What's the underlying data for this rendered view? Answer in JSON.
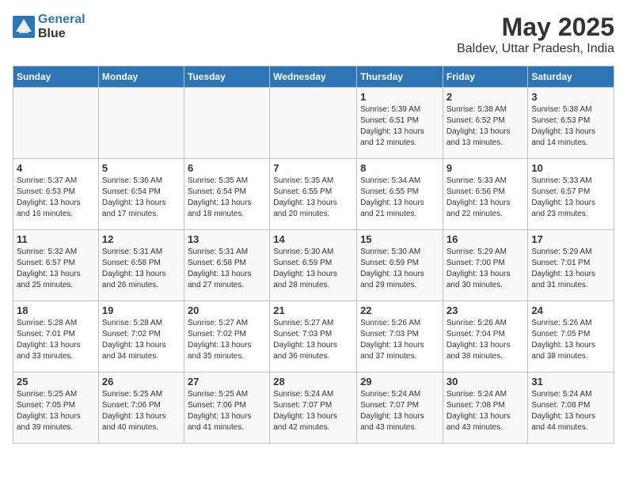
{
  "header": {
    "logo_line1": "General",
    "logo_line2": "Blue",
    "month_year": "May 2025",
    "location": "Baldev, Uttar Pradesh, India"
  },
  "days_of_week": [
    "Sunday",
    "Monday",
    "Tuesday",
    "Wednesday",
    "Thursday",
    "Friday",
    "Saturday"
  ],
  "weeks": [
    [
      {
        "day": "",
        "info": ""
      },
      {
        "day": "",
        "info": ""
      },
      {
        "day": "",
        "info": ""
      },
      {
        "day": "",
        "info": ""
      },
      {
        "day": "1",
        "info": "Sunrise: 5:39 AM\nSunset: 6:51 PM\nDaylight: 13 hours\nand 12 minutes."
      },
      {
        "day": "2",
        "info": "Sunrise: 5:38 AM\nSunset: 6:52 PM\nDaylight: 13 hours\nand 13 minutes."
      },
      {
        "day": "3",
        "info": "Sunrise: 5:38 AM\nSunset: 6:53 PM\nDaylight: 13 hours\nand 14 minutes."
      }
    ],
    [
      {
        "day": "4",
        "info": "Sunrise: 5:37 AM\nSunset: 6:53 PM\nDaylight: 13 hours\nand 16 minutes."
      },
      {
        "day": "5",
        "info": "Sunrise: 5:36 AM\nSunset: 6:54 PM\nDaylight: 13 hours\nand 17 minutes."
      },
      {
        "day": "6",
        "info": "Sunrise: 5:35 AM\nSunset: 6:54 PM\nDaylight: 13 hours\nand 18 minutes."
      },
      {
        "day": "7",
        "info": "Sunrise: 5:35 AM\nSunset: 6:55 PM\nDaylight: 13 hours\nand 20 minutes."
      },
      {
        "day": "8",
        "info": "Sunrise: 5:34 AM\nSunset: 6:55 PM\nDaylight: 13 hours\nand 21 minutes."
      },
      {
        "day": "9",
        "info": "Sunrise: 5:33 AM\nSunset: 6:56 PM\nDaylight: 13 hours\nand 22 minutes."
      },
      {
        "day": "10",
        "info": "Sunrise: 5:33 AM\nSunset: 6:57 PM\nDaylight: 13 hours\nand 23 minutes."
      }
    ],
    [
      {
        "day": "11",
        "info": "Sunrise: 5:32 AM\nSunset: 6:57 PM\nDaylight: 13 hours\nand 25 minutes."
      },
      {
        "day": "12",
        "info": "Sunrise: 5:31 AM\nSunset: 6:58 PM\nDaylight: 13 hours\nand 26 minutes."
      },
      {
        "day": "13",
        "info": "Sunrise: 5:31 AM\nSunset: 6:58 PM\nDaylight: 13 hours\nand 27 minutes."
      },
      {
        "day": "14",
        "info": "Sunrise: 5:30 AM\nSunset: 6:59 PM\nDaylight: 13 hours\nand 28 minutes."
      },
      {
        "day": "15",
        "info": "Sunrise: 5:30 AM\nSunset: 6:59 PM\nDaylight: 13 hours\nand 29 minutes."
      },
      {
        "day": "16",
        "info": "Sunrise: 5:29 AM\nSunset: 7:00 PM\nDaylight: 13 hours\nand 30 minutes."
      },
      {
        "day": "17",
        "info": "Sunrise: 5:29 AM\nSunset: 7:01 PM\nDaylight: 13 hours\nand 31 minutes."
      }
    ],
    [
      {
        "day": "18",
        "info": "Sunrise: 5:28 AM\nSunset: 7:01 PM\nDaylight: 13 hours\nand 33 minutes."
      },
      {
        "day": "19",
        "info": "Sunrise: 5:28 AM\nSunset: 7:02 PM\nDaylight: 13 hours\nand 34 minutes."
      },
      {
        "day": "20",
        "info": "Sunrise: 5:27 AM\nSunset: 7:02 PM\nDaylight: 13 hours\nand 35 minutes."
      },
      {
        "day": "21",
        "info": "Sunrise: 5:27 AM\nSunset: 7:03 PM\nDaylight: 13 hours\nand 36 minutes."
      },
      {
        "day": "22",
        "info": "Sunrise: 5:26 AM\nSunset: 7:03 PM\nDaylight: 13 hours\nand 37 minutes."
      },
      {
        "day": "23",
        "info": "Sunrise: 5:26 AM\nSunset: 7:04 PM\nDaylight: 13 hours\nand 38 minutes."
      },
      {
        "day": "24",
        "info": "Sunrise: 5:26 AM\nSunset: 7:05 PM\nDaylight: 13 hours\nand 38 minutes."
      }
    ],
    [
      {
        "day": "25",
        "info": "Sunrise: 5:25 AM\nSunset: 7:05 PM\nDaylight: 13 hours\nand 39 minutes."
      },
      {
        "day": "26",
        "info": "Sunrise: 5:25 AM\nSunset: 7:06 PM\nDaylight: 13 hours\nand 40 minutes."
      },
      {
        "day": "27",
        "info": "Sunrise: 5:25 AM\nSunset: 7:06 PM\nDaylight: 13 hours\nand 41 minutes."
      },
      {
        "day": "28",
        "info": "Sunrise: 5:24 AM\nSunset: 7:07 PM\nDaylight: 13 hours\nand 42 minutes."
      },
      {
        "day": "29",
        "info": "Sunrise: 5:24 AM\nSunset: 7:07 PM\nDaylight: 13 hours\nand 43 minutes."
      },
      {
        "day": "30",
        "info": "Sunrise: 5:24 AM\nSunset: 7:08 PM\nDaylight: 13 hours\nand 43 minutes."
      },
      {
        "day": "31",
        "info": "Sunrise: 5:24 AM\nSunset: 7:08 PM\nDaylight: 13 hours\nand 44 minutes."
      }
    ]
  ]
}
